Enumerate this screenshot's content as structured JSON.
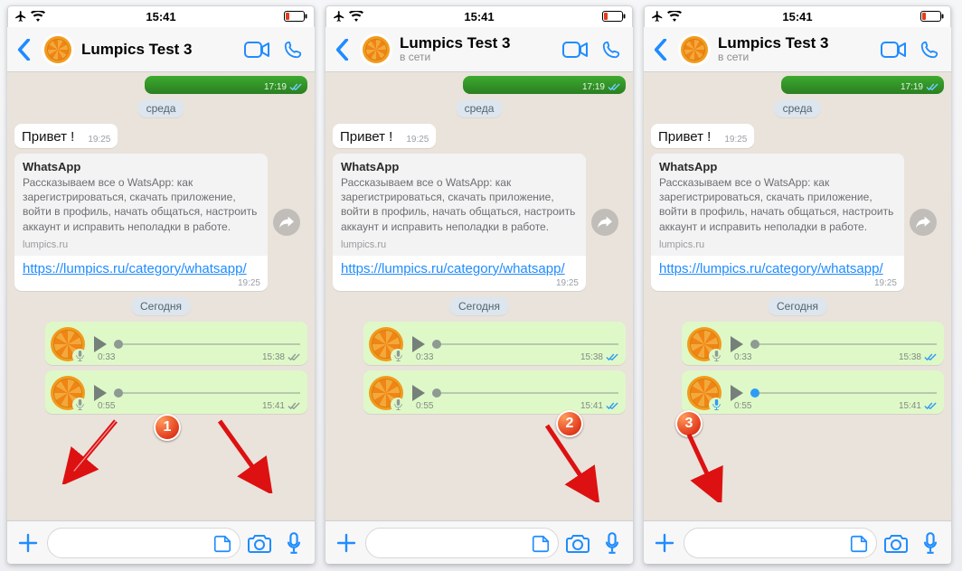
{
  "status": {
    "time": "15:41"
  },
  "header": {
    "contact_name": "Lumpics Test 3",
    "online_status": "в сети"
  },
  "chat": {
    "top_image_time": "17:19",
    "date1": "среда",
    "hello": {
      "text": "Привет !",
      "time": "19:25"
    },
    "link": {
      "preview_title": "WhatsApp",
      "preview_desc": "Рассказываем все о WatsApp: как зарегистрироваться, скачать приложение, войти в профиль, начать общаться, настроить аккаунт и исправить неполадки в работе.",
      "domain": "lumpics.ru",
      "url": "https://lumpics.ru/category/whatsapp/",
      "time": "19:25"
    },
    "date2": "Сегодня",
    "voice1": {
      "duration": "0:33",
      "time": "15:38"
    },
    "voice2": {
      "duration": "0:55",
      "time": "15:41"
    }
  },
  "badges": {
    "b1": "1",
    "b2": "2",
    "b3": "3"
  }
}
